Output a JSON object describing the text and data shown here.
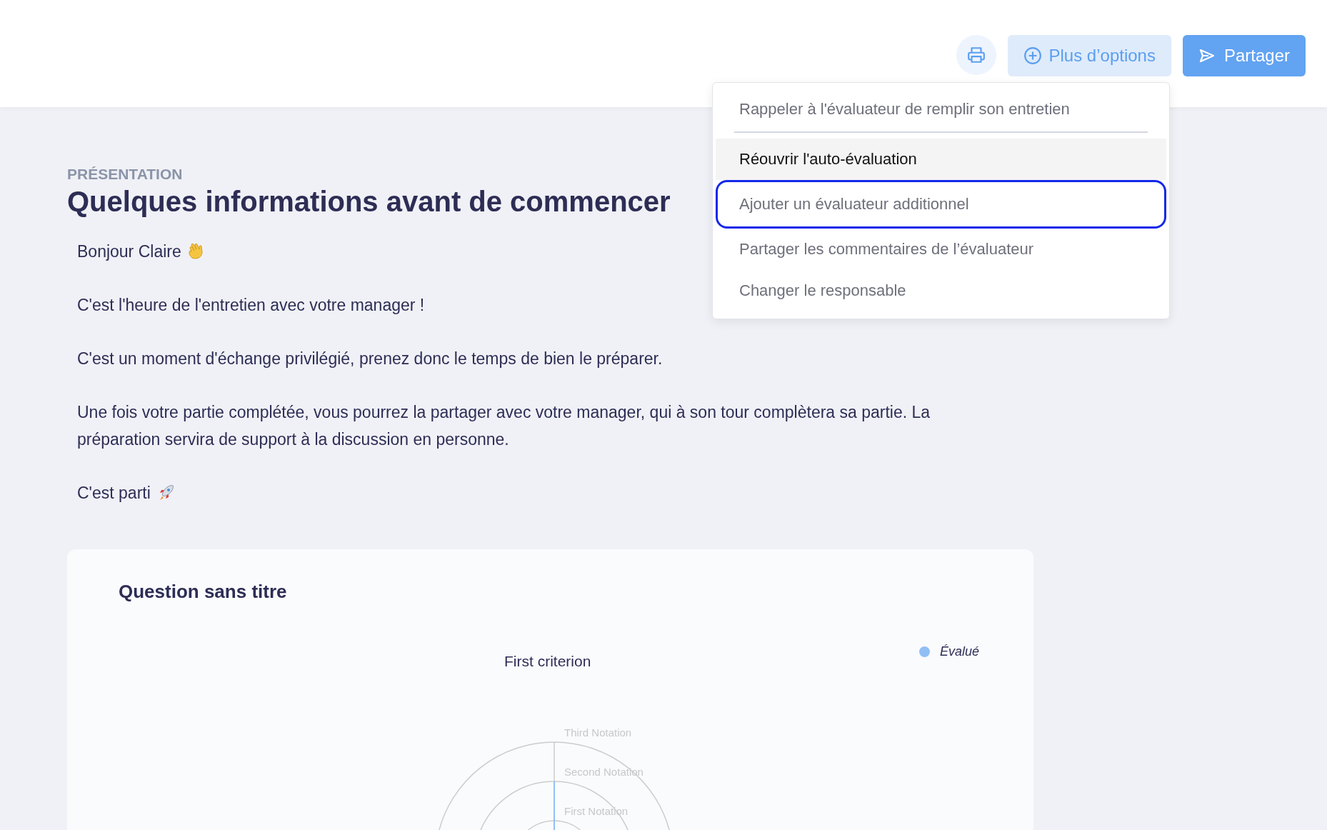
{
  "toolbar": {
    "buttons": [
      {
        "kind": "print"
      },
      {
        "kind": "options",
        "label": "Plus d’options"
      },
      {
        "kind": "share",
        "label": "Partager"
      }
    ]
  },
  "menu": {
    "items": [
      {
        "label": "Rappeler à l'évaluateur de remplir son entretien",
        "hovered": false,
        "focused": false,
        "divider_after": true
      },
      {
        "label": "Réouvrir l'auto-évaluation",
        "hovered": true,
        "focused": false,
        "divider_after": false
      },
      {
        "label": "Ajouter un évaluateur additionnel",
        "hovered": false,
        "focused": true,
        "divider_after": false
      },
      {
        "label": "Partager les commentaires de l’évaluateur",
        "hovered": false,
        "focused": false,
        "divider_after": false
      },
      {
        "label": "Changer le responsable",
        "hovered": false,
        "focused": false,
        "divider_after": false
      }
    ]
  },
  "section": {
    "eyebrow": "PRÉSENTATION",
    "title": "Quelques informations avant de commencer",
    "paragraphs": [
      {
        "text": "Bonjour Claire",
        "kind": "greeting"
      },
      {
        "text": "C'est l'heure de l'entretien avec votre manager !",
        "kind": "plain"
      },
      {
        "text": "C'est un moment d'échange privilégié, prenez donc le temps de bien le préparer.",
        "kind": "plain"
      },
      {
        "text": "Une fois votre partie complétée, vous pourrez la partager avec votre manager, qui à son tour complètera sa partie. La préparation servira de support à la discussion en personne.",
        "kind": "plain"
      },
      {
        "text": "C'est parti",
        "kind": "launch"
      }
    ]
  },
  "card": {
    "title": "Question sans titre",
    "chart": {
      "axis_label": "First criterion",
      "rings": [
        "Third Notation",
        "Second Notation",
        "First Notation"
      ],
      "legend": [
        {
          "label": "Évalué",
          "color": "#90bff5"
        }
      ]
    }
  }
}
